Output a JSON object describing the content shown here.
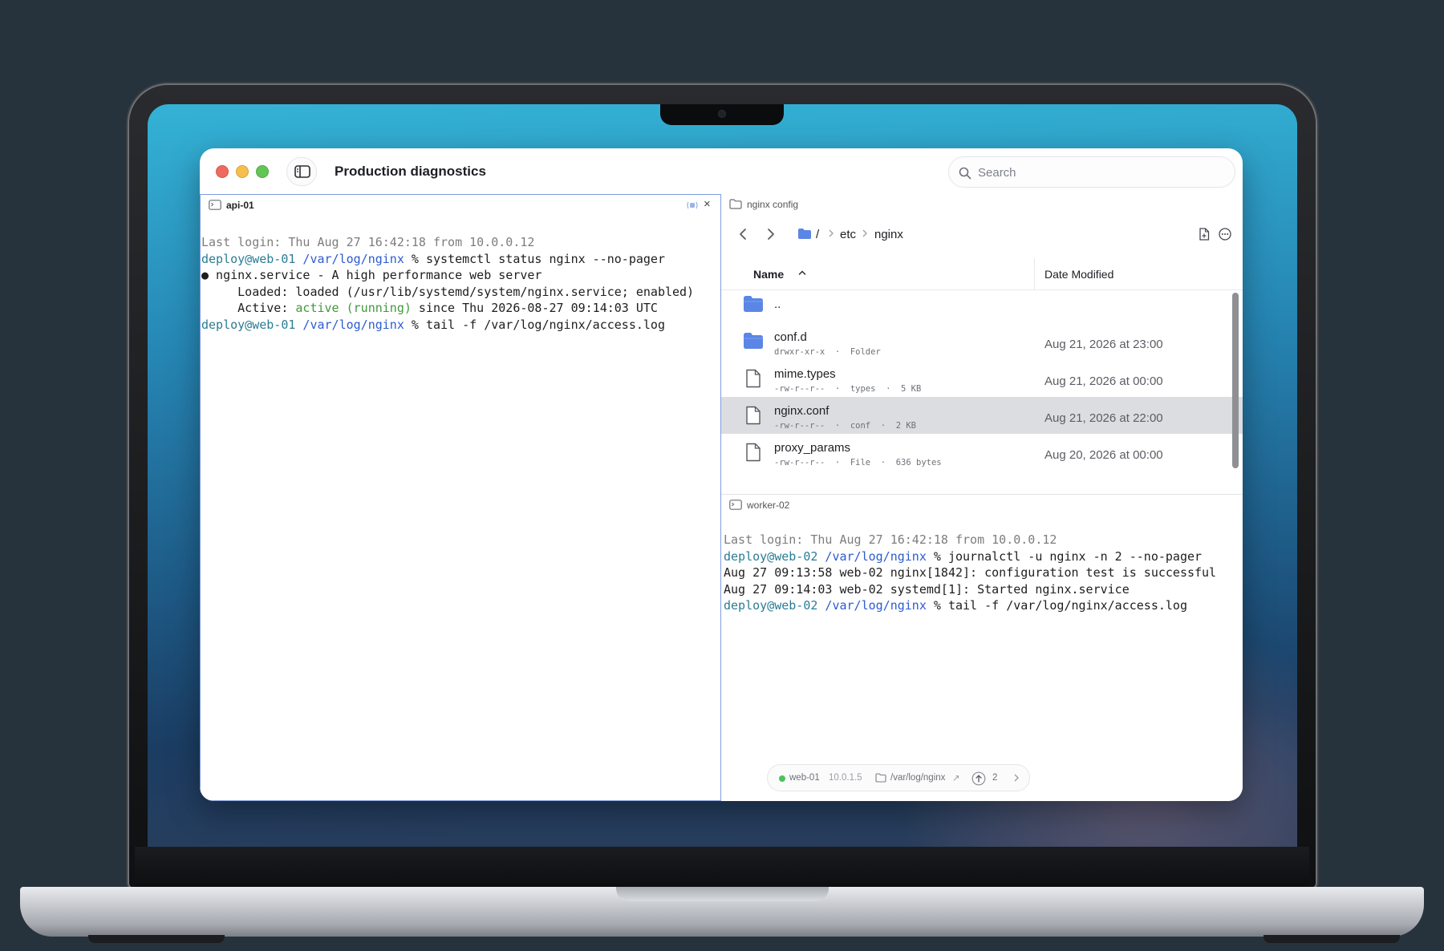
{
  "window": {
    "title": "Production diagnostics"
  },
  "search": {
    "placeholder": "Search"
  },
  "left_pane": {
    "title": "api-01",
    "close_label": "×",
    "lines": [
      [
        {
          "t": "Last login: Thu Aug 27 16:42:18 from 10.0.0.12",
          "c": "gray"
        }
      ],
      [
        {
          "t": "deploy@web-01",
          "c": "teal"
        },
        {
          "t": " /var/log/nginx",
          "c": "blue"
        },
        {
          "t": " % systemctl status nginx --no-pager",
          "c": ""
        }
      ],
      [
        {
          "t": "● nginx.service - A high performance web server",
          "c": ""
        }
      ],
      [
        {
          "t": "     Loaded: loaded (/usr/lib/systemd/system/nginx.service; enabled)",
          "c": ""
        }
      ],
      [
        {
          "t": "     Active: ",
          "c": ""
        },
        {
          "t": "active (running)",
          "c": "green"
        },
        {
          "t": " since Thu 2026-08-27 09:14:03 UTC",
          "c": ""
        }
      ],
      [
        {
          "t": "deploy@web-01",
          "c": "teal"
        },
        {
          "t": " /var/log/nginx",
          "c": "blue"
        },
        {
          "t": " % tail -f /var/log/nginx/access.log",
          "c": ""
        }
      ]
    ]
  },
  "files_pane": {
    "title": "nginx config",
    "breadcrumb": [
      "/",
      "etc",
      "nginx"
    ],
    "columns": {
      "name": "Name",
      "date": "Date Modified"
    },
    "rows": [
      {
        "name": "..",
        "meta": "",
        "date": "",
        "kind": "folder",
        "selected": false
      },
      {
        "name": "conf.d",
        "meta": "drwxr-xr-x  ·  Folder",
        "date": "Aug 21, 2026 at 23:00",
        "kind": "folder",
        "selected": false
      },
      {
        "name": "mime.types",
        "meta": "-rw-r--r--  ·  types  ·  5 KB",
        "date": "Aug 21, 2026 at 00:00",
        "kind": "file",
        "selected": false
      },
      {
        "name": "nginx.conf",
        "meta": "-rw-r--r--  ·  conf  ·  2 KB",
        "date": "Aug 21, 2026 at 22:00",
        "kind": "file",
        "selected": true
      },
      {
        "name": "proxy_params",
        "meta": "-rw-r--r--  ·  File  ·  636 bytes",
        "date": "Aug 20, 2026 at 00:00",
        "kind": "file",
        "selected": false
      }
    ]
  },
  "bottom_pane": {
    "title": "worker-02",
    "lines": [
      [
        {
          "t": "Last login: Thu Aug 27 16:42:18 from 10.0.0.12",
          "c": "gray"
        }
      ],
      [
        {
          "t": "deploy@web-02",
          "c": "teal"
        },
        {
          "t": " /var/log/nginx",
          "c": "blue"
        },
        {
          "t": " % journalctl -u nginx -n 2 --no-pager",
          "c": ""
        }
      ],
      [
        {
          "t": "Aug 27 09:13:58 web-02 nginx[1842]: configuration test is successful",
          "c": ""
        }
      ],
      [
        {
          "t": "Aug 27 09:14:03 web-02 systemd[1]: Started nginx.service",
          "c": ""
        }
      ],
      [
        {
          "t": "deploy@web-02",
          "c": "teal"
        },
        {
          "t": " /var/log/nginx",
          "c": "blue"
        },
        {
          "t": " % tail -f /var/log/nginx/access.log",
          "c": ""
        }
      ]
    ]
  },
  "status": {
    "host": "web-01",
    "ip": "10.0.1.5",
    "directory": "/var/log/nginx",
    "directory_arrow": "↗",
    "count": "2",
    "online_color": "#4cc35a"
  },
  "colors": {
    "accent_border": "#7f9be0",
    "folder": "#5b86e5",
    "selection": "#dcdde0"
  }
}
